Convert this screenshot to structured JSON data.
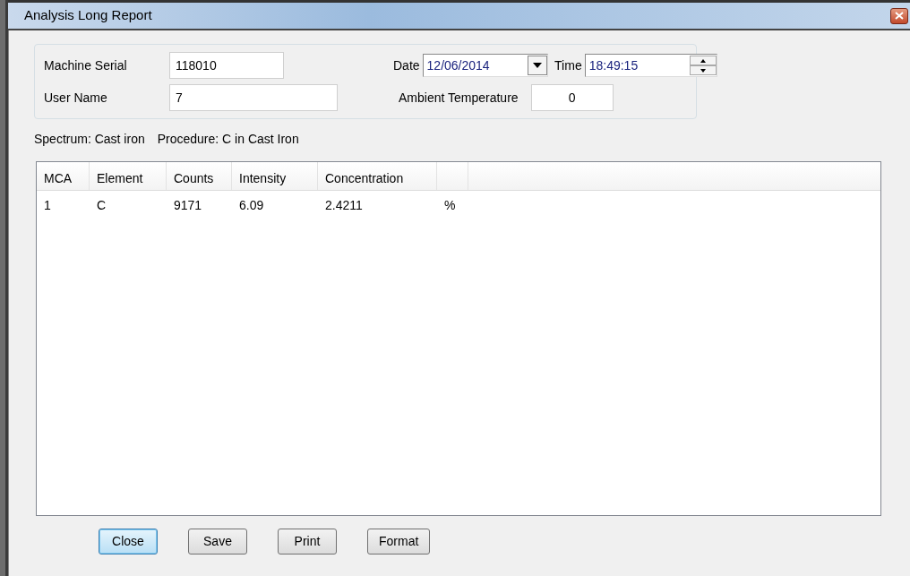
{
  "window": {
    "title": "Analysis Long Report"
  },
  "fields": {
    "machine_serial": {
      "label": "Machine Serial",
      "value": "118010"
    },
    "user_name": {
      "label": "User Name",
      "value": "7"
    },
    "date": {
      "label": "Date",
      "value": "12/06/2014"
    },
    "time": {
      "label": "Time",
      "value": "18:49:15"
    },
    "ambient_temperature": {
      "label": "Ambient Temperature",
      "value": "0"
    }
  },
  "spectrum": "Spectrum: Cast iron",
  "procedure": "Procedure: C in Cast Iron",
  "table": {
    "columns": [
      "MCA",
      "Element",
      "Counts",
      "Intensity",
      "Concentration"
    ],
    "rows": [
      [
        "1",
        "C",
        "9171",
        "6.09",
        "2.4211",
        "%"
      ]
    ]
  },
  "buttons": [
    {
      "label": "Close",
      "focused": true
    },
    {
      "label": "Save",
      "focused": false
    },
    {
      "label": "Print",
      "focused": false
    },
    {
      "label": "Format",
      "focused": false
    }
  ]
}
